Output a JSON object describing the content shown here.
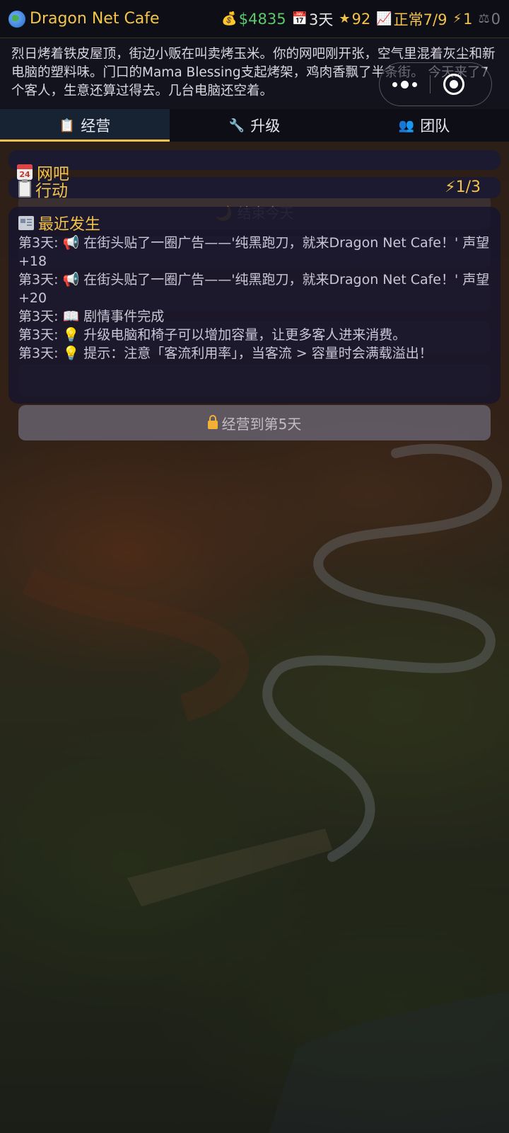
{
  "app": {
    "title": "Dragon Net Cafe"
  },
  "stats": {
    "money": "$4835",
    "day": "3天",
    "reputation": "92",
    "status": "正常7/9",
    "energy": "1",
    "balance": "0"
  },
  "narrative": "烈日烤着铁皮屋顶，街边小贩在叫卖烤玉米。你的网吧刚开张，空气里混着灰尘和新电脑的塑料味。门口的Mama Blessing支起烤架，鸡肉香飘了半条街。 今天来了7个客人，生意还算过得去。几台电脑还空着。",
  "tabs": [
    {
      "label": "经营",
      "icon": "clipboard-icon",
      "active": true
    },
    {
      "label": "升级",
      "icon": "wrench-icon",
      "active": false
    },
    {
      "label": "团队",
      "icon": "team-icon",
      "active": false
    }
  ],
  "sections": {
    "cafe_title": "网吧",
    "cafe_date_icon": "24",
    "actions_title": "行动",
    "actions_counter": "⚡1/3"
  },
  "ghost_buttons": {
    "end_day": "🌙 结束今天"
  },
  "events": {
    "title": "最近发生",
    "items": [
      {
        "text": "第3天: 📢 在街头贴了一圈广告——'纯黑跑刀，就来Dragon Net Cafe！' 声望+18"
      },
      {
        "text": "第3天: 📢 在街头贴了一圈广告——'纯黑跑刀，就来Dragon Net Cafe！' 声望+20"
      },
      {
        "text": "第3天: 📖 剧情事件完成"
      },
      {
        "text": "第3天: 💡 升级电脑和椅子可以增加容量，让更多客人进来消费。"
      },
      {
        "text": "第3天: 💡 提示：注意「客流利用率」，当客流 > 容量时会满载溢出！"
      }
    ]
  },
  "locked_button": {
    "label": "经营到第5天"
  },
  "colors": {
    "accent": "#f2c24a",
    "money": "#5ec86b",
    "panel": "#1c1a30"
  }
}
